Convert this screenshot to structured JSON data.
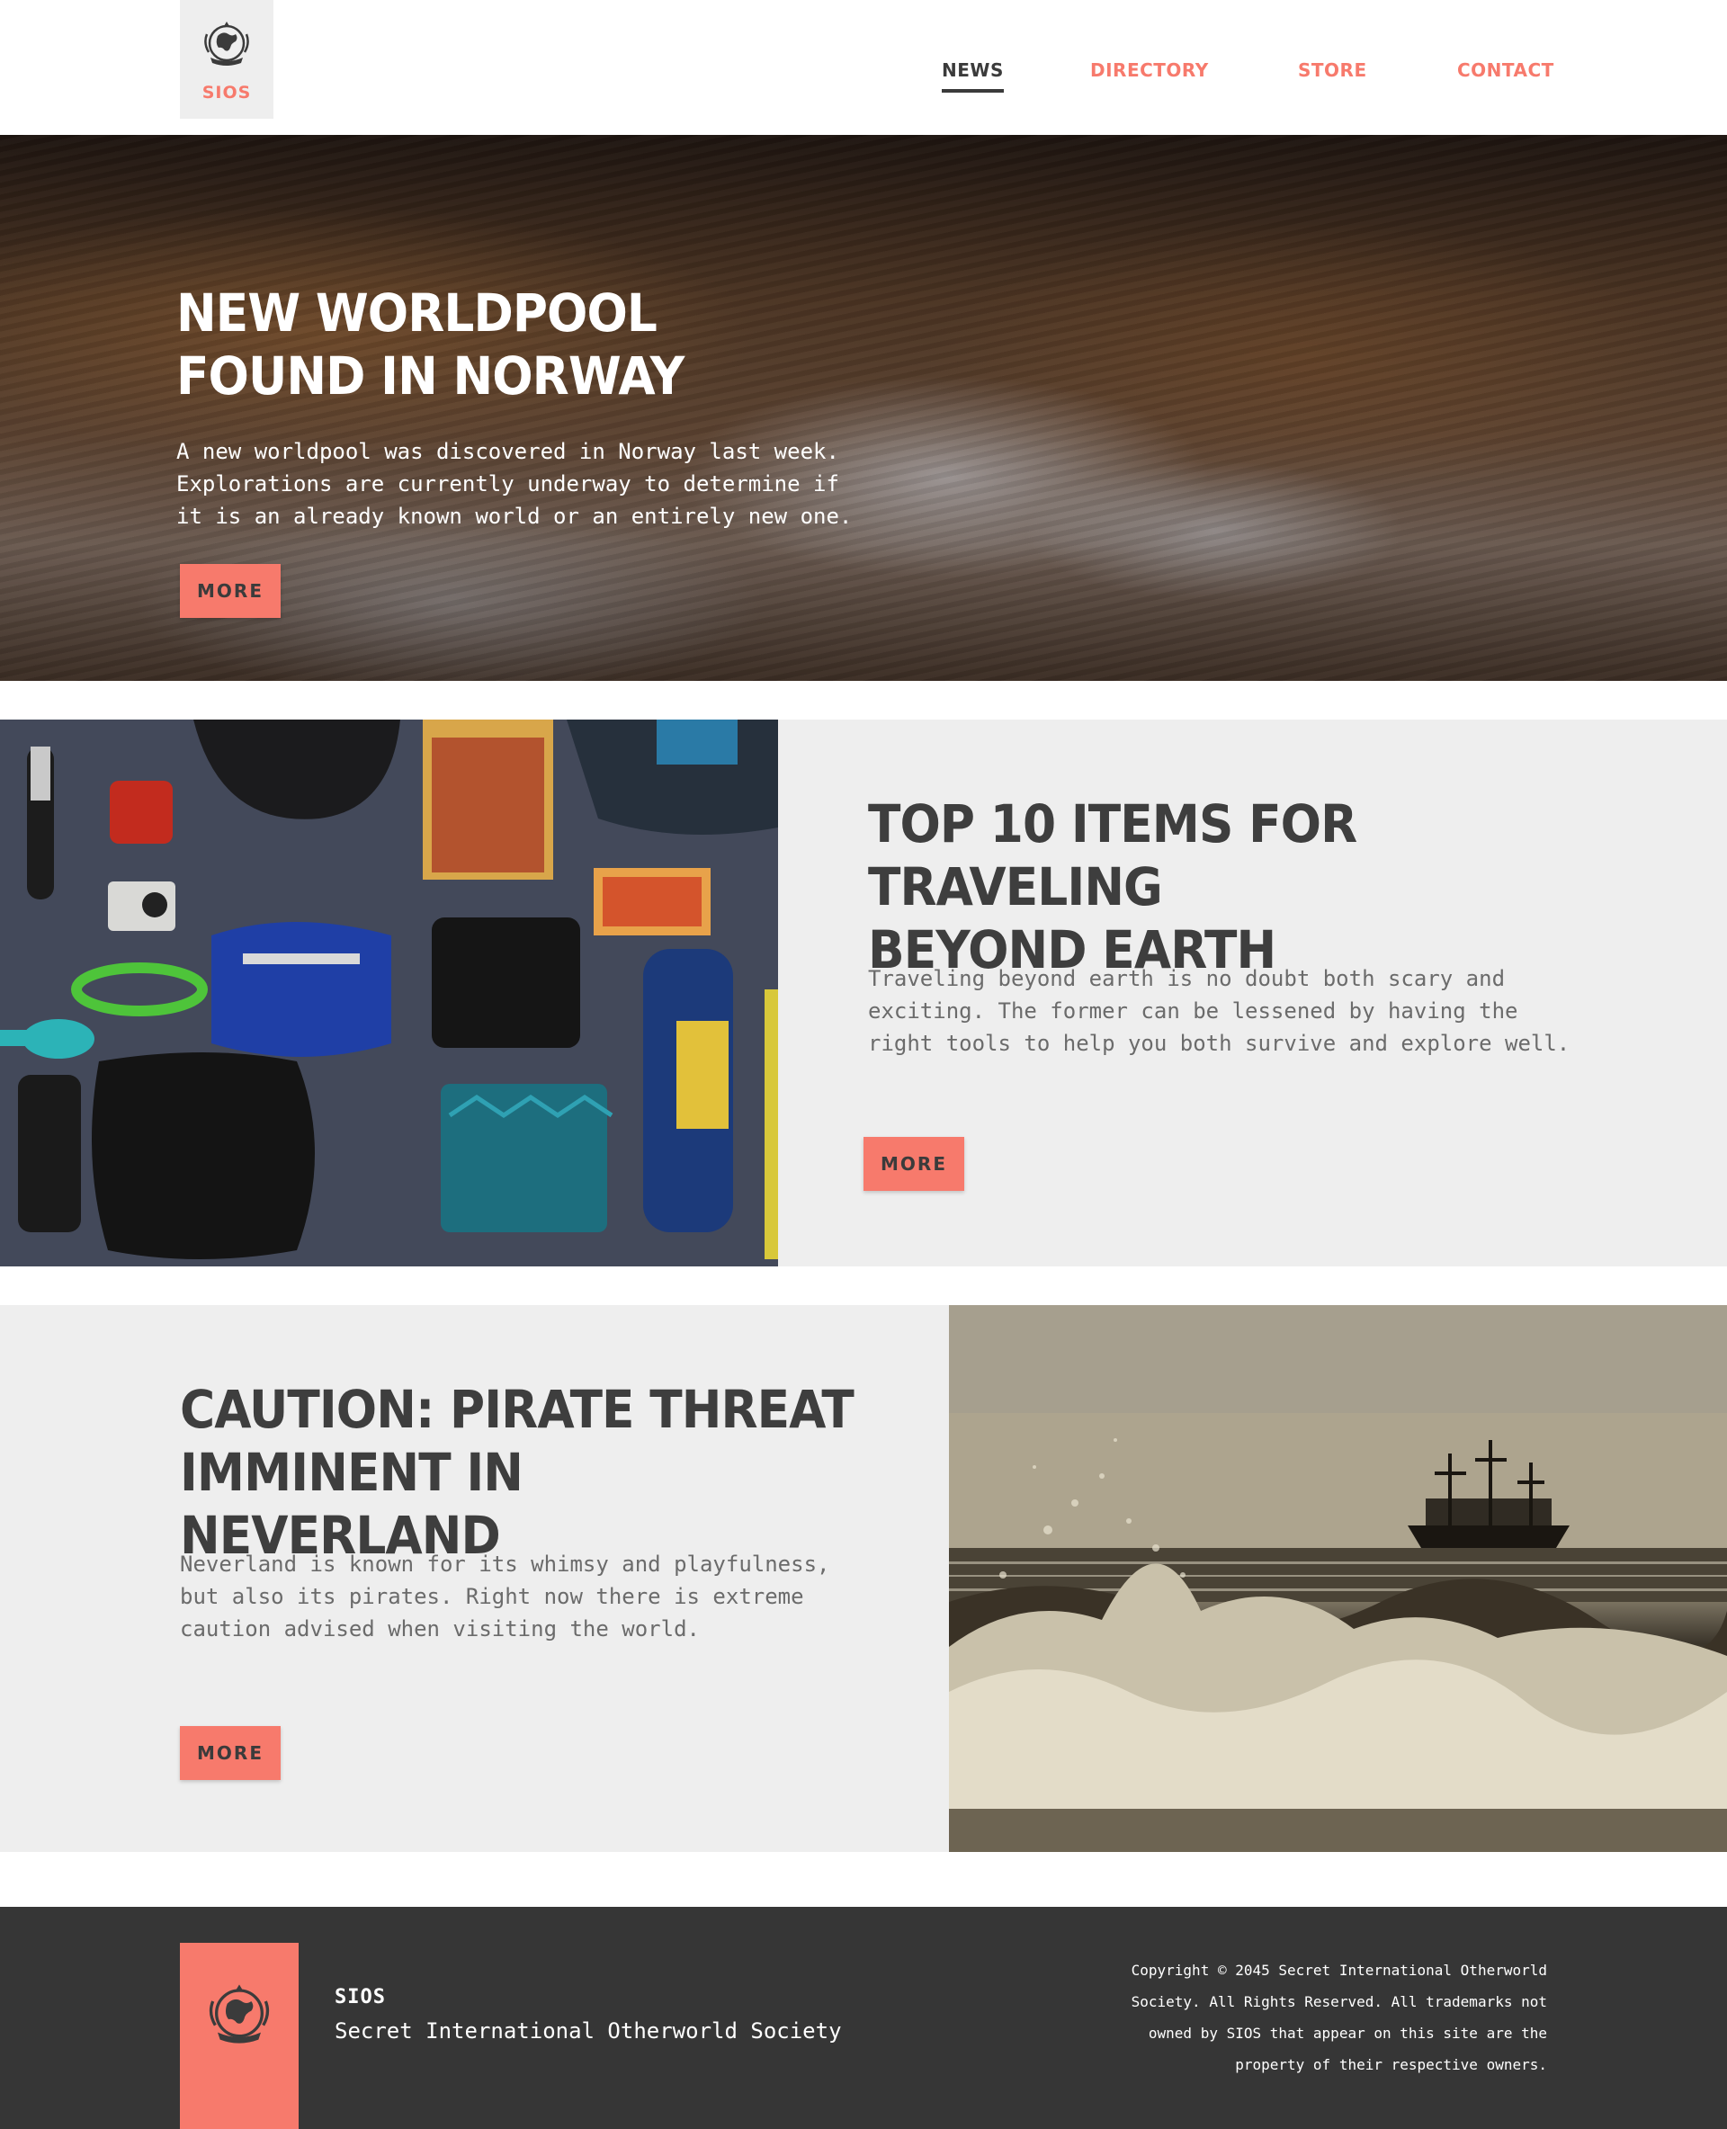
{
  "header": {
    "logo_label": "SIOS",
    "nav": [
      {
        "label": "NEWS",
        "active": true
      },
      {
        "label": "DIRECTORY",
        "active": false
      },
      {
        "label": "STORE",
        "active": false
      },
      {
        "label": "CONTACT",
        "active": false
      }
    ]
  },
  "hero": {
    "title_line1": "NEW WORLDPOOL",
    "title_line2": "FOUND IN NORWAY",
    "text_line1": "A new worldpool was discovered in Norway last week.",
    "text_line2": "Explorations are currently underway to determine if",
    "text_line3": "it is an already known world or an entirely new one.",
    "button": "MORE"
  },
  "article1": {
    "title_line1": "TOP 10 ITEMS FOR TRAVELING",
    "title_line2": "BEYOND EARTH",
    "text_line1": "Traveling beyond earth is no doubt both scary and",
    "text_line2": "exciting. The former can be lessened by having the",
    "text_line3": "right tools to help you both survive and explore well.",
    "button": "MORE"
  },
  "article2": {
    "title_line1": "CAUTION: PIRATE THREAT",
    "title_line2": "IMMINENT IN NEVERLAND",
    "text_line1": "Neverland is known for its whimsy and playfulness,",
    "text_line2": "but also its pirates. Right now there is extreme",
    "text_line3": "caution advised when visiting the world.",
    "button": "MORE"
  },
  "footer": {
    "brand": "SIOS",
    "name": "Secret International Otherworld Society",
    "copyright_line1": "Copyright © 2045 Secret International Otherworld",
    "copyright_line2": "Society. All Rights Reserved. All trademarks not",
    "copyright_line3": "owned by SIOS that appear on this site are the",
    "copyright_line4": "property of their respective owners."
  },
  "colors": {
    "accent": "#f77a6c",
    "dark_text": "#3e3e3e",
    "panel_bg": "#eeeeee",
    "footer_bg": "#363636"
  },
  "icons": {
    "logo": "globe-crest-icon"
  }
}
